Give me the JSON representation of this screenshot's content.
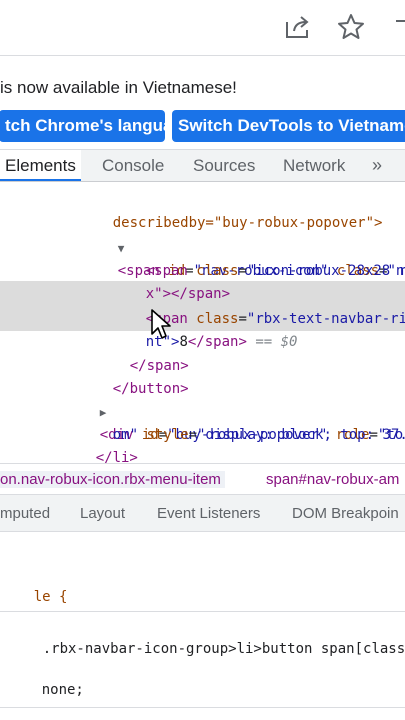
{
  "toolbar": {
    "icons": [
      "share-icon",
      "star-icon"
    ]
  },
  "banner": {
    "message": "is now available in Vietnamese!",
    "button_language": "tch Chrome's language",
    "button_devtools": "Switch DevTools to Vietnamese"
  },
  "tabs": {
    "elements": "Elements",
    "console": "Console",
    "sources": "Sources",
    "network": "Network",
    "more": "»"
  },
  "dom": {
    "l0": "describedby=\"buy-robux-popover\">",
    "l1_tag": "<span ",
    "l1_attr": "id",
    "l1_val": "\"nav-robux-icon\"",
    "l1_attr2": " class",
    "l1_val2": "\"n",
    "l2_tag": "<span ",
    "l2_attr": "class",
    "l2_val": "\"icon-robux-28x28 ro",
    "l3": "x\"></span>",
    "l4_tag": "<span ",
    "l4_attr": "class",
    "l4_val": "\"rbx-text-navbar-rig",
    "l5_a": "nt\">",
    "l5_b": "8",
    "l5_c": "</span>",
    "l5_eq": " == $0",
    "l6": "</span>",
    "l7": "</button>",
    "l8_tag": "<div ",
    "l8_attr": "id",
    "l8_val": "\"buy-robux-popover\"",
    "l8_attr2": " role",
    "l8_val2": "\"to",
    "l9_a": "om\"",
    "l9_attr": " style",
    "l9_val": "\"display: block; top: 37.9",
    "l10": "</li>"
  },
  "breadcrumb": {
    "first": "on.nav-robux-icon.rbx-menu-item",
    "second": "span#nav-robux-am"
  },
  "subtabs": {
    "computed": "mputed",
    "layout": "Layout",
    "listeners": "Event Listeners",
    "dom_breakpoints": "DOM Breakpoin"
  },
  "styles": {
    "rule1": "le {",
    "selector": ".rbx-navbar-icon-group>li>button span[class^",
    "decl": "none;"
  }
}
